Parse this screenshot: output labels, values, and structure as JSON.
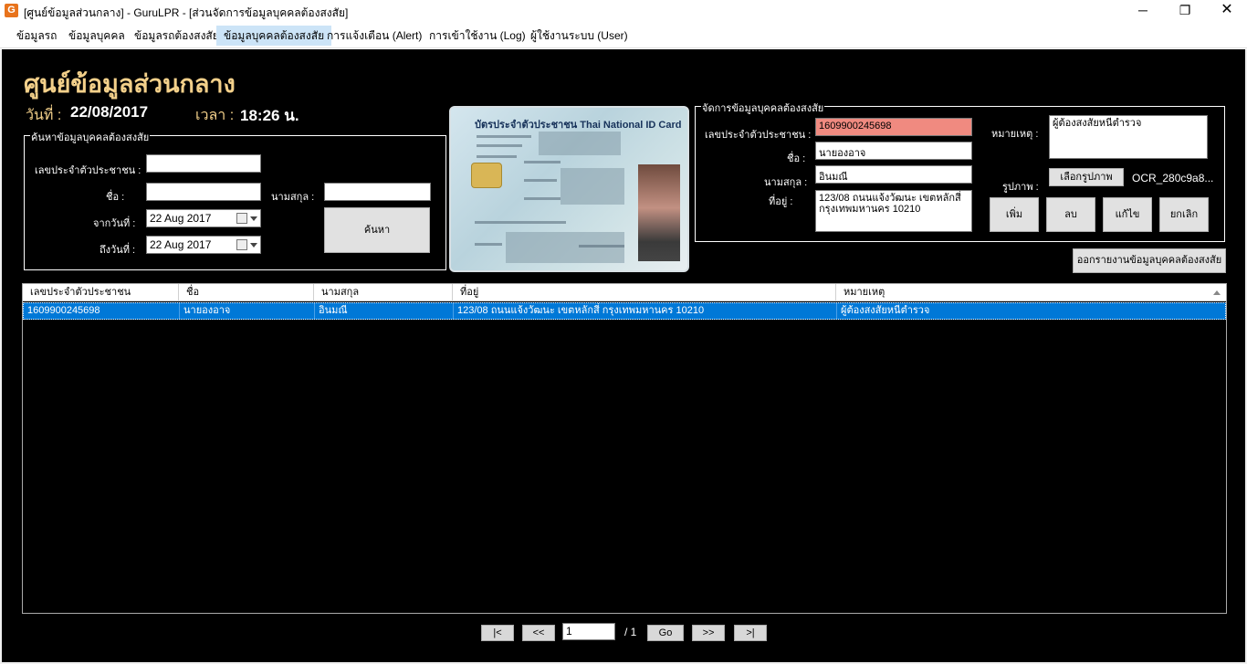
{
  "window": {
    "title": "[ศูนย์ข้อมูลส่วนกลาง] - GuruLPR - [ส่วนจัดการข้อมูลบุคคลต้องสงสัย]",
    "icon_text": "G",
    "minimize_icon": "─",
    "maximize_icon": "❐",
    "close_icon": "✕"
  },
  "menu": [
    {
      "label": "ข้อมูลรถ"
    },
    {
      "label": "ข้อมูลบุคคล"
    },
    {
      "label": "ข้อมูลรถต้องสงสัย"
    },
    {
      "label": "ข้อมูลบุคคลต้องสงสัย"
    },
    {
      "label": "การแจ้งเตือน (Alert)"
    },
    {
      "label": "การเข้าใช้งาน (Log)"
    },
    {
      "label": "ผู้ใช้งานระบบ (User)"
    }
  ],
  "header": {
    "title": "ศูนย์ข้อมูลส่วนกลาง",
    "date_label": "วันที่ :",
    "date_value": "22/08/2017",
    "time_label": "เวลา :",
    "time_value": "18:26 น."
  },
  "search": {
    "legend": "ค้นหาข้อมูลบุคคลต้องสงสัย",
    "id_label": "เลขประจำตัวประชาชน :",
    "id_value": "",
    "name_label": "ชื่อ :",
    "name_value": "",
    "surname_label": "นามสกุล :",
    "surname_value": "",
    "from_label": "จากวันที่ :",
    "from_value": "22 Aug 2017",
    "to_label": "ถึงวันที่ :",
    "to_value": "22 Aug 2017",
    "search_button": "ค้นหา"
  },
  "idcard": {
    "heading": "บัตรประจำตัวประชาชน  Thai National ID Card"
  },
  "manage": {
    "legend": "จัดการข้อมูลบุคคลต้องสงสัย",
    "id_label": "เลขประจำตัวประชาชน :",
    "id_value": "1609900245698",
    "name_label": "ชื่อ :",
    "name_value": "นายองอาจ",
    "surname_label": "นามสกุล :",
    "surname_value": "อินมณี",
    "address_label": "ที่อยู่ :",
    "address_value": "123/08 ถนนแจ้งวัฒนะ เขตหลักสี่ กรุงเทพมหานคร 10210",
    "note_label": "หมายเหตุ :",
    "note_value": "ผู้ต้องสงสัยหนีตำรวจ",
    "image_label": "รูปภาพ :",
    "choose_image_button": "เลือกรูปภาพ",
    "image_filename": "OCR_280c9a8...",
    "add_button": "เพิ่ม",
    "delete_button": "ลบ",
    "edit_button": "แก้ไข",
    "cancel_button": "ยกเลิก",
    "report_button": "ออกรายงานข้อมูลบุคคลต้องสงสัย"
  },
  "grid": {
    "columns": [
      "เลขประจำตัวประชาชน",
      "ชื่อ",
      "นามสกุล",
      "ที่อยู่",
      "หมายเหตุ"
    ],
    "rows": [
      [
        "1609900245698",
        "นายองอาจ",
        "อินมณี",
        "123/08 ถนนแจ้งวัฒนะ เขตหลักสี่ กรุงเทพมหานคร 10210",
        "ผู้ต้องสงสัยหนีตำรวจ"
      ]
    ]
  },
  "pager": {
    "first": "|<",
    "prev": "<<",
    "page_value": "1",
    "total": "/ 1",
    "go": "Go",
    "next": ">>",
    "last": ">|"
  }
}
